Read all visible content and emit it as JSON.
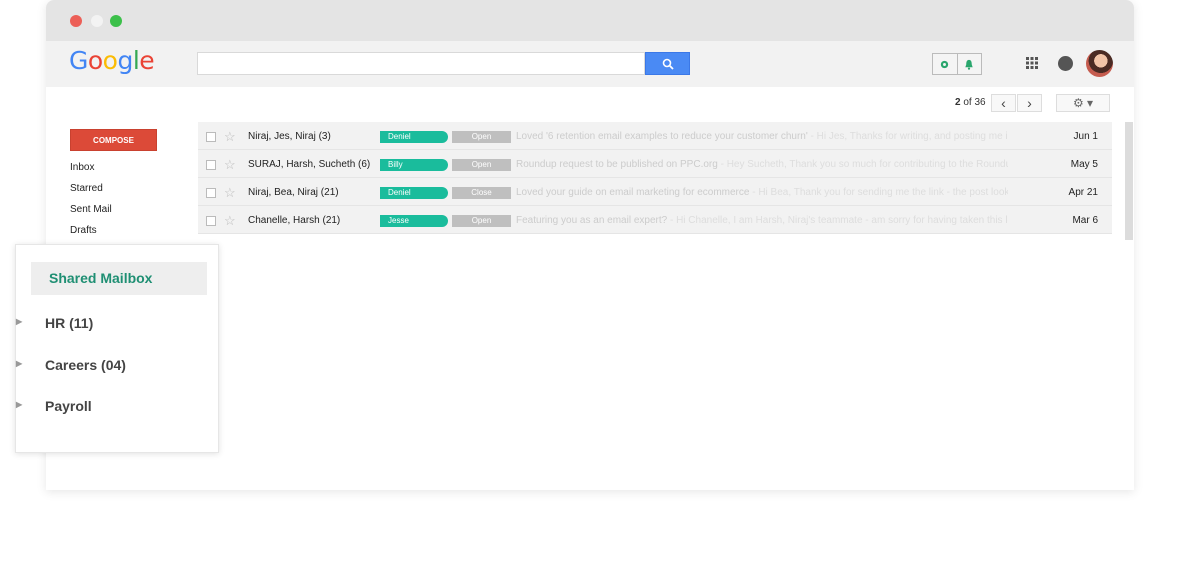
{
  "browser": {
    "title": ""
  },
  "header": {
    "logo_letters": [
      "G",
      "o",
      "o",
      "g",
      "l",
      "e"
    ],
    "search_value": "",
    "search_icon": "search-icon",
    "ext_icons": [
      "gear-icon",
      "bell-icon"
    ],
    "apps_icon": "apps-grid-icon",
    "notification_icon": "notification-icon",
    "avatar_icon": "user-avatar"
  },
  "toolbar": {
    "pager_current": "2",
    "pager_text": " of 36",
    "prev": "‹",
    "next": "›",
    "settings": "⚙ ▾"
  },
  "sidebar": {
    "compose": "COMPOSE",
    "items": [
      {
        "label": "Inbox"
      },
      {
        "label": "Starred"
      },
      {
        "label": "Sent Mail"
      },
      {
        "label": "Drafts"
      }
    ]
  },
  "emails": [
    {
      "from": "Niraj, Jes, Niraj (3)",
      "assignee": "Deniel",
      "status": "Open",
      "subject": "Loved '6 retention email examples to reduce your customer churn'",
      "snippet": " - Hi Jes, Thanks for writing, and posting me in t",
      "date": "Jun 1"
    },
    {
      "from": "SURAJ, Harsh, Sucheth (6)",
      "assignee": "Billy",
      "status": "Open",
      "subject": "Roundup request to be published on PPC.org",
      "snippet": " - Hey Sucheth, Thank you so much for contributing to the Roundup",
      "date": "May 5"
    },
    {
      "from": "Niraj, Bea, Niraj (21)",
      "assignee": "Deniel",
      "status": "Close",
      "subject": "Loved your guide on email marketing for ecommerce",
      "snippet": " - Hi Bea, Thank you for sending me the link - the post looks g",
      "date": "Apr 21"
    },
    {
      "from": "Chanelle, Harsh (21)",
      "assignee": "Jesse",
      "status": "Open",
      "subject": "Featuring you as an email expert?",
      "snippet": " - Hi Chanelle, I am Harsh, Niraj's teammate - am sorry for having taken this long",
      "date": "Mar 6"
    }
  ],
  "shared_mailbox": {
    "title": "Shared Mailbox",
    "folders": [
      {
        "label": "HR (11)"
      },
      {
        "label": "Careers (04)"
      },
      {
        "label": "Payroll"
      }
    ]
  },
  "colors": {
    "accent": "#1abc9c",
    "compose": "#dc4a38",
    "search": "#4a8af4",
    "shared_title": "#1f8f73"
  }
}
